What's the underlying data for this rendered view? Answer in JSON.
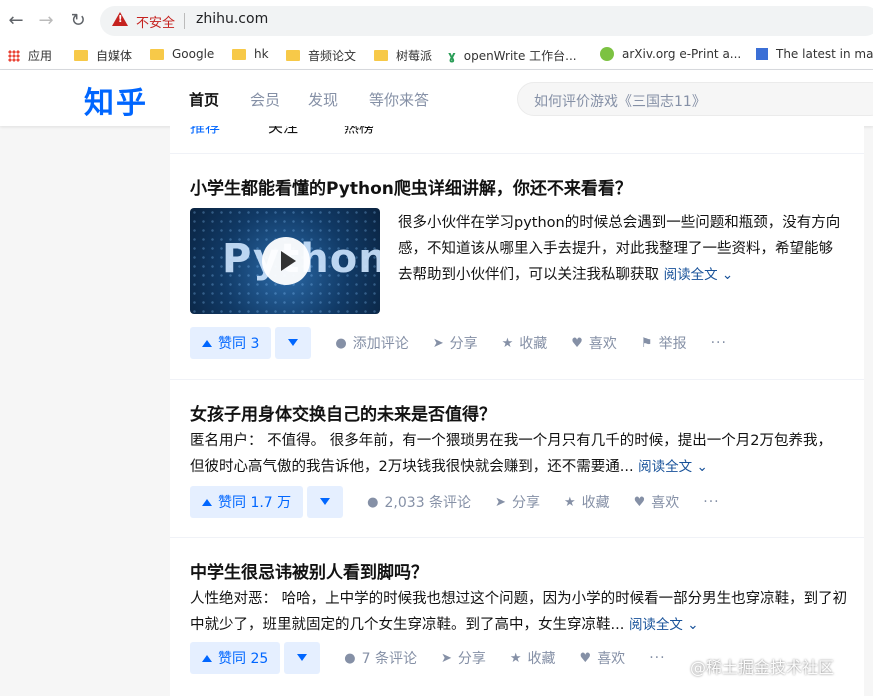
{
  "browser": {
    "insecure_label": "不安全",
    "url": "zhihu.com",
    "bookmarks": [
      {
        "label": "应用",
        "icon": "apps-grid-icon"
      },
      {
        "label": "自媒体",
        "icon": "folder-icon"
      },
      {
        "label": "Google",
        "icon": "folder-icon"
      },
      {
        "label": "hk",
        "icon": "folder-icon"
      },
      {
        "label": "音频论文",
        "icon": "folder-icon"
      },
      {
        "label": "树莓派",
        "icon": "folder-icon"
      },
      {
        "label": "openWrite 工作台...",
        "icon": "openwrite-icon"
      },
      {
        "label": "arXiv.org e-Print a...",
        "icon": "arxiv-icon"
      },
      {
        "label": "The latest in mac",
        "icon": "bookmark-icon"
      }
    ]
  },
  "header": {
    "logo": "知乎",
    "nav": [
      "首页",
      "会员",
      "发现",
      "等你来答"
    ],
    "search_placeholder": "如何评价游戏《三国志11》"
  },
  "subtabs": [
    "推荐",
    "关注",
    "热榜"
  ],
  "feed": [
    {
      "title": "小学生都能看懂的Python爬虫详细讲解，你还不来看看？",
      "thumb_text": "Python",
      "excerpt": "很多小伙伴在学习python的时候总会遇到一些问题和瓶颈，没有方向感，不知道该从哪里入手去提升，对此我整理了一些资料，希望能够去帮助到小伙伴们，可以关注我私聊获取",
      "readmore": "阅读全文 ⌄",
      "vote": "赞同 3",
      "actions": [
        "添加评论",
        "分享",
        "收藏",
        "喜欢",
        "举报"
      ]
    },
    {
      "title": "女孩子用身体交换自己的未来是否值得？",
      "excerpt": "匿名用户： 不值得。 很多年前，有一个猥琐男在我一个月只有几千的时候，提出一个月2万包养我，但彼时心高气傲的我告诉他，2万块钱我很快就会赚到，还不需要通...",
      "readmore": "阅读全文 ⌄",
      "vote": "赞同 1.7 万",
      "actions": [
        "2,033 条评论",
        "分享",
        "收藏",
        "喜欢"
      ]
    },
    {
      "title": "中学生很忌讳被别人看到脚吗？",
      "excerpt": "人性绝对恶： 哈哈，上中学的时候我也想过这个问题，因为小学的时候看一部分男生也穿凉鞋，到了初中就少了，班里就固定的几个女生穿凉鞋。到了高中，女生穿凉鞋...",
      "readmore": "阅读全文 ⌄",
      "vote": "赞同 25",
      "actions": [
        "7 条评论",
        "分享",
        "收藏",
        "喜欢"
      ]
    }
  ],
  "more_label": "···",
  "watermark": "@稀土掘金技术社区",
  "colors": {
    "brand": "#0066ff",
    "link": "#175199",
    "muted": "#8590a6",
    "warning": "#c5221f"
  }
}
